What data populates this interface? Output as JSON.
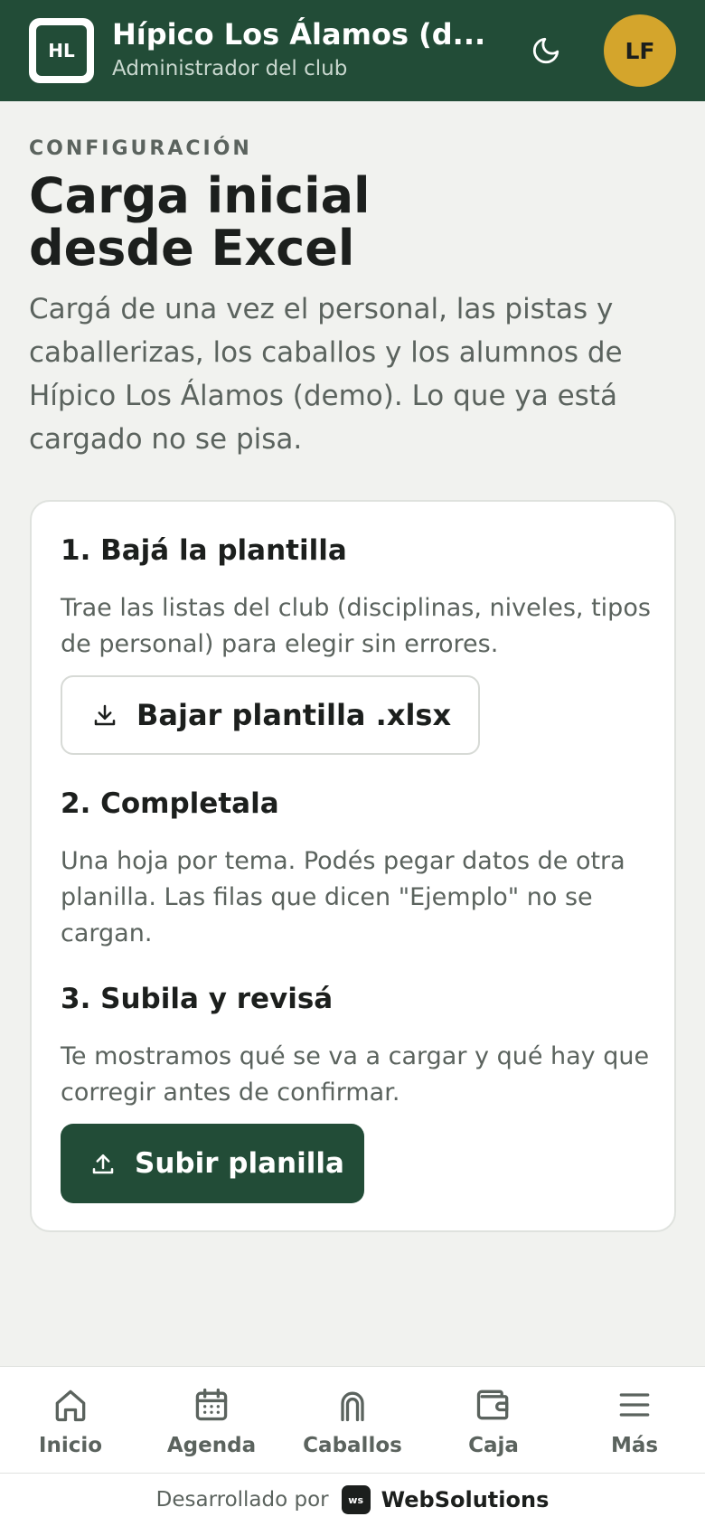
{
  "header": {
    "logo_initials": "HL",
    "club_name": "Hípico Los Álamos (d...",
    "role": "Administrador del club",
    "theme_icon": "moon-icon",
    "avatar_initials": "LF"
  },
  "page": {
    "eyebrow": "CONFIGURACIÓN",
    "title": "Carga inicial desde Excel",
    "description": "Cargá de una vez el personal, las pistas y caballerizas, los caballos y los alumnos de Hípico Los Álamos (demo). Lo que ya está cargado no se pisa."
  },
  "steps": [
    {
      "title": "1. Bajá la plantilla",
      "description": "Trae las listas del club (disciplinas, niveles, tipos de personal) para elegir sin errores.",
      "button_label": "Bajar plantilla .xlsx",
      "button_icon": "download-icon"
    },
    {
      "title": "2. Completala",
      "description": "Una hoja por tema. Podés pegar datos de otra planilla. Las filas que dicen \"Ejemplo\" no se cargan."
    },
    {
      "title": "3. Subila y revisá",
      "description": "Te mostramos qué se va a cargar y qué hay que corregir antes de confirmar.",
      "button_label": "Subir planilla",
      "button_icon": "upload-icon"
    }
  ],
  "nav": [
    {
      "label": "Inicio",
      "icon": "home-icon"
    },
    {
      "label": "Agenda",
      "icon": "calendar-icon"
    },
    {
      "label": "Caballos",
      "icon": "horseshoe-icon"
    },
    {
      "label": "Caja",
      "icon": "wallet-icon"
    },
    {
      "label": "Más",
      "icon": "menu-icon"
    }
  ],
  "footer": {
    "prefix": "Desarrollado por",
    "badge": "ws",
    "brand": "WebSolutions"
  },
  "colors": {
    "primary": "#224c37",
    "avatar": "#d4a52c",
    "background": "#f1f2ef"
  }
}
